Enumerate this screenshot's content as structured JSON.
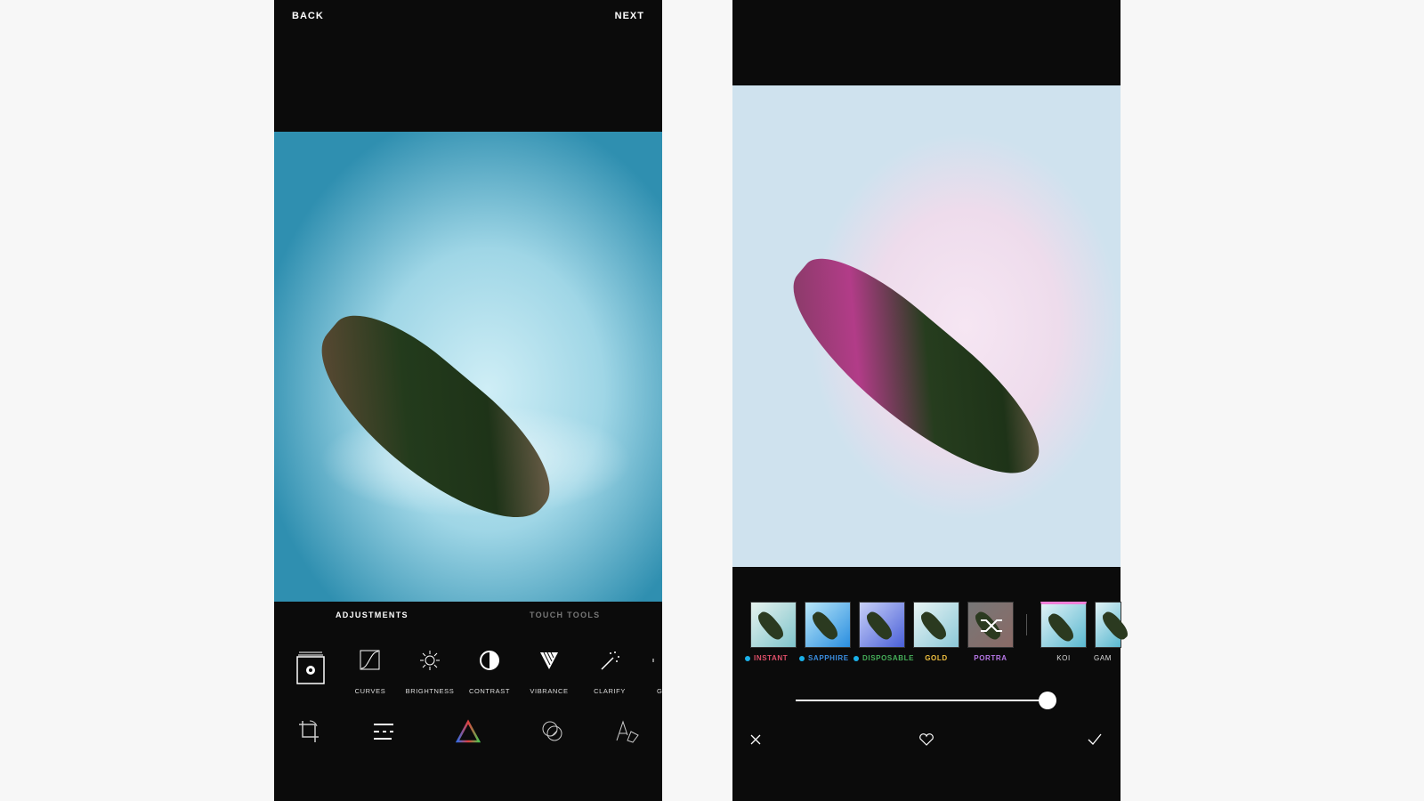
{
  "left_screen": {
    "back_label": "BACK",
    "next_label": "NEXT",
    "tabs": [
      {
        "label": "ADJUSTMENTS",
        "active": true
      },
      {
        "label": "TOUCH TOOLS",
        "active": false
      }
    ],
    "tools": [
      {
        "label": "",
        "icon": "presets-gear-icon"
      },
      {
        "label": "CURVES",
        "icon": "curves-icon"
      },
      {
        "label": "BRIGHTNESS",
        "icon": "sun-icon"
      },
      {
        "label": "CONTRAST",
        "icon": "contrast-icon"
      },
      {
        "label": "VIBRANCE",
        "icon": "vibrance-icon"
      },
      {
        "label": "CLARIFY",
        "icon": "magic-wand-icon"
      },
      {
        "label": "G",
        "icon": "partial-icon"
      }
    ],
    "bottom_nav": [
      "crop-rotate-icon",
      "sliders-icon",
      "color-triangle-icon",
      "overlay-icon",
      "text-pen-icon"
    ]
  },
  "right_screen": {
    "filters": [
      {
        "label": "INSTANT",
        "color": "#e0506a",
        "dot": true
      },
      {
        "label": "SAPPHIRE",
        "color": "#3b8ee0",
        "dot": true
      },
      {
        "label": "DISPOSABLE",
        "color": "#46b05a",
        "dot": true
      },
      {
        "label": "GOLD",
        "color": "#f0c040",
        "dot": false
      },
      {
        "label": "PORTRA",
        "color": "#b878e8",
        "dot": false,
        "selected": true,
        "icon": "shuffle-icon"
      },
      {
        "label": "KOI",
        "color": "#dddddd",
        "dot": false
      },
      {
        "label": "GAM",
        "color": "#dddddd",
        "dot": false
      }
    ],
    "intensity_percent": 100,
    "actions": [
      "close-icon",
      "heart-icon",
      "check-icon"
    ]
  }
}
